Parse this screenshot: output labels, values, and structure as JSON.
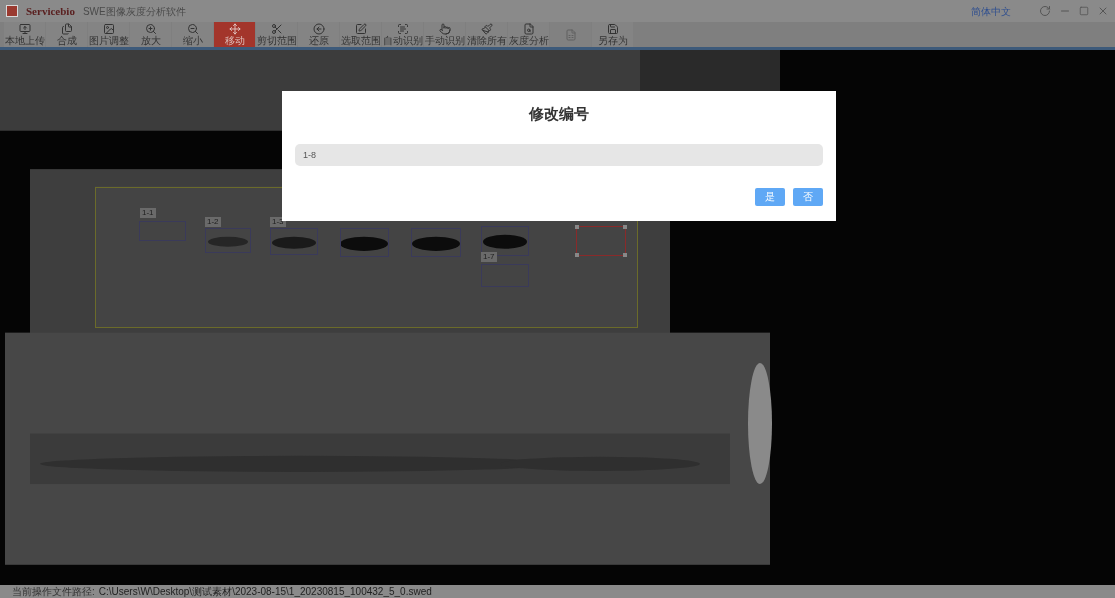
{
  "window": {
    "brand": "Servicebio",
    "title": "SWE图像灰度分析软件",
    "language": "简体中文"
  },
  "toolbar": [
    {
      "label": "本地上传",
      "selected": false,
      "disabled": false
    },
    {
      "label": "合成",
      "selected": false,
      "disabled": false
    },
    {
      "label": "图片调整",
      "selected": false,
      "disabled": false
    },
    {
      "label": "放大",
      "selected": false,
      "disabled": false
    },
    {
      "label": "缩小",
      "selected": false,
      "disabled": false
    },
    {
      "label": "移动",
      "selected": true,
      "disabled": false
    },
    {
      "label": "剪切范围",
      "selected": false,
      "disabled": false
    },
    {
      "label": "还原",
      "selected": false,
      "disabled": false
    },
    {
      "label": "选取范围",
      "selected": false,
      "disabled": false
    },
    {
      "label": "自动识别",
      "selected": false,
      "disabled": false
    },
    {
      "label": "手动识别",
      "selected": false,
      "disabled": false
    },
    {
      "label": "清除所有",
      "selected": false,
      "disabled": false
    },
    {
      "label": "灰度分析",
      "selected": false,
      "disabled": false
    },
    {
      "disabled": true,
      "selected": false
    },
    {
      "label": "另存为",
      "selected": false,
      "disabled": false
    }
  ],
  "lanes": [
    {
      "label": "1-1",
      "selected": false
    },
    {
      "label": "1-2",
      "selected": false
    },
    {
      "label": "1-3",
      "selected": false
    },
    {
      "selected": false
    },
    {
      "selected": false
    },
    {
      "selected": false
    },
    {
      "label": "1-7",
      "selected": false
    },
    {
      "selected": true
    }
  ],
  "dialog": {
    "title": "修改编号",
    "value": "1-8",
    "buttons": [
      "是",
      "否"
    ]
  },
  "status_bar": {
    "label": "当前操作文件路径:",
    "path": "C:\\Users\\W\\Desktop\\测试素材\\2023-08-15\\1_20230815_100432_5_0.swed"
  }
}
